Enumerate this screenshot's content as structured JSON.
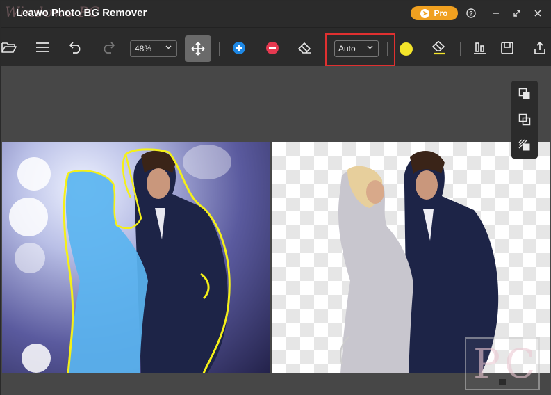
{
  "app": {
    "title": "Leawo Photo BG Remover",
    "watermark_text": "Windows PC",
    "pro_label": "Pro"
  },
  "toolbar": {
    "zoom_value": "48%",
    "mode_value": "Auto",
    "brush_color": "#f4e52a"
  },
  "corner_watermark": "PC",
  "colors": {
    "accent": "#f0a020",
    "toolbar_bg": "#2b2b2b",
    "highlight_border": "#e03030",
    "add_button": "#1e88e5",
    "remove_button": "#e53950",
    "selection_overlay": "#5ab4f0",
    "selection_outline": "#f4f018"
  }
}
